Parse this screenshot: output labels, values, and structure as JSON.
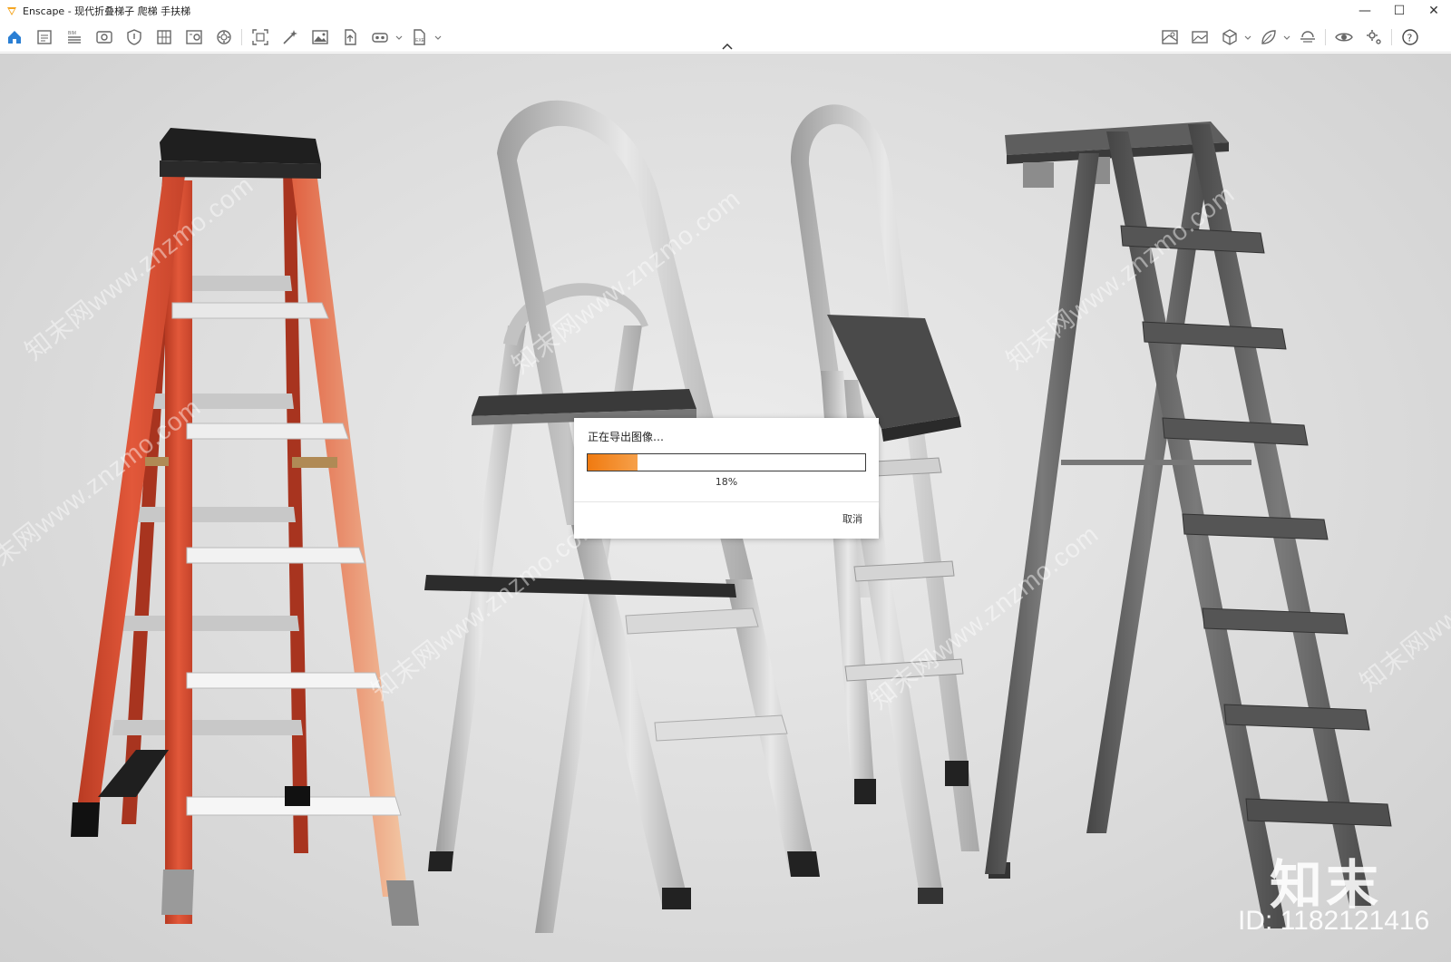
{
  "window": {
    "title": "Enscape - 现代折叠梯子 爬梯 手扶梯",
    "minimize_glyph": "—",
    "maximize_glyph": "☐",
    "close_glyph": "✕"
  },
  "toolbar": {
    "left_icons": [
      "home-icon",
      "document-icon",
      "bim-icon",
      "view-icon",
      "shield-icon",
      "building-icon",
      "photo-gallery-icon",
      "render-sphere-icon",
      "screenshot-icon",
      "magic-wand-icon",
      "image-icon",
      "upload-file-icon",
      "vr-headset-icon",
      "export-file-icon"
    ],
    "right_icons": [
      "map-icon",
      "panorama-icon",
      "cube-icon",
      "leaf-icon",
      "atmosphere-icon",
      "eye-icon",
      "settings-icon",
      "help-icon"
    ]
  },
  "dialog": {
    "title": "正在导出图像…",
    "progress_percent": 18,
    "progress_label": "18%",
    "cancel_label": "取消"
  },
  "watermark": {
    "site": "知末网www.znzmo.com",
    "brand": "知末",
    "id_label": "ID: 1182121416"
  },
  "colors": {
    "accent_orange": "#f07a10",
    "ladder_red": "#d8482a",
    "ladder_silver": "#c9c9c9",
    "ladder_dark": "#5a5a5a",
    "home_icon_blue": "#2a7fd4"
  }
}
